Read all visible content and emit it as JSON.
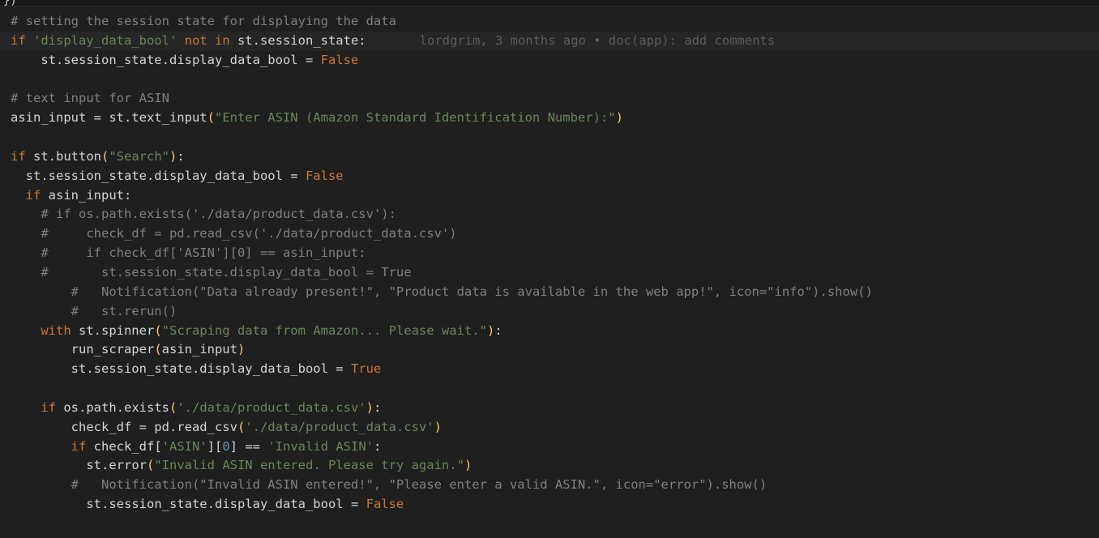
{
  "editor": {
    "top_fragment": "})",
    "blame": "lordgrim, 3 months ago • doc(app): add comments",
    "lines": [
      {
        "indent": 0,
        "tokens": [
          [
            "cmt",
            "# setting the session state for displaying the data"
          ]
        ]
      },
      {
        "indent": 0,
        "current": true,
        "tokens": [
          [
            "kw",
            "if "
          ],
          [
            "str",
            "'display_data_bool'"
          ],
          [
            "kw",
            " not in"
          ],
          [
            "txt",
            " st.session_state:"
          ]
        ]
      },
      {
        "indent": 2,
        "tokens": [
          [
            "txt",
            "st.session_state.display_data_bool = "
          ],
          [
            "bool",
            "False"
          ]
        ]
      },
      {
        "indent": 0,
        "tokens": []
      },
      {
        "indent": 0,
        "tokens": [
          [
            "cmt",
            "# text input for ASIN"
          ]
        ]
      },
      {
        "indent": 0,
        "tokens": [
          [
            "txt",
            "asin_input = st.text_input"
          ],
          [
            "par",
            "("
          ],
          [
            "str",
            "\"Enter ASIN (Amazon Standard Identification Number):\""
          ],
          [
            "par",
            ")"
          ]
        ]
      },
      {
        "indent": 0,
        "tokens": []
      },
      {
        "indent": 0,
        "tokens": [
          [
            "kw",
            "if"
          ],
          [
            "txt",
            " st.button"
          ],
          [
            "par",
            "("
          ],
          [
            "str",
            "\"Search\""
          ],
          [
            "par",
            ")"
          ],
          [
            "txt",
            ":"
          ]
        ]
      },
      {
        "indent": 1,
        "tokens": [
          [
            "txt",
            "st.session_state.display_data_bool = "
          ],
          [
            "bool",
            "False"
          ]
        ]
      },
      {
        "indent": 1,
        "tokens": [
          [
            "kw",
            "if"
          ],
          [
            "txt",
            " asin_input:"
          ]
        ]
      },
      {
        "indent": 2,
        "tokens": [
          [
            "cmt",
            "# if os.path.exists('./data/product_data.csv'):"
          ]
        ]
      },
      {
        "indent": 2,
        "tokens": [
          [
            "cmt",
            "#     check_df = pd.read_csv('./data/product_data.csv')"
          ]
        ]
      },
      {
        "indent": 2,
        "tokens": [
          [
            "cmt",
            "#     if check_df['ASIN'][0] == asin_input:"
          ]
        ]
      },
      {
        "indent": 2,
        "tokens": [
          [
            "cmt",
            "#       st.session_state.display_data_bool = True"
          ]
        ]
      },
      {
        "indent": 4,
        "tokens": [
          [
            "cmt",
            "#   Notification(\"Data already present!\", \"Product data is available in the web app!\", icon=\"info\").show()"
          ]
        ]
      },
      {
        "indent": 4,
        "tokens": [
          [
            "cmt",
            "#   st.rerun()"
          ]
        ]
      },
      {
        "indent": 2,
        "tokens": [
          [
            "kw",
            "with"
          ],
          [
            "txt",
            " st.spinner"
          ],
          [
            "par",
            "("
          ],
          [
            "str",
            "\"Scraping data from Amazon... Please wait.\""
          ],
          [
            "par",
            ")"
          ],
          [
            "txt",
            ":"
          ]
        ]
      },
      {
        "indent": 4,
        "tokens": [
          [
            "txt",
            "run_scraper"
          ],
          [
            "par",
            "("
          ],
          [
            "txt",
            "asin_input"
          ],
          [
            "par",
            ")"
          ]
        ]
      },
      {
        "indent": 4,
        "tokens": [
          [
            "txt",
            "st.session_state.display_data_bool = "
          ],
          [
            "bool",
            "True"
          ]
        ]
      },
      {
        "indent": 0,
        "tokens": []
      },
      {
        "indent": 2,
        "tokens": [
          [
            "kw",
            "if"
          ],
          [
            "txt",
            " os.path.exists"
          ],
          [
            "par",
            "("
          ],
          [
            "str",
            "'./data/product_data.csv'"
          ],
          [
            "par",
            ")"
          ],
          [
            "txt",
            ":"
          ]
        ]
      },
      {
        "indent": 4,
        "tokens": [
          [
            "txt",
            "check_df = pd.read_csv"
          ],
          [
            "par",
            "("
          ],
          [
            "str",
            "'./data/product_data.csv'"
          ],
          [
            "par",
            ")"
          ]
        ]
      },
      {
        "indent": 4,
        "tokens": [
          [
            "kw",
            "if"
          ],
          [
            "txt",
            " check_df["
          ],
          [
            "str",
            "'ASIN'"
          ],
          [
            "txt",
            "]["
          ],
          [
            "num",
            "0"
          ],
          [
            "txt",
            "] == "
          ],
          [
            "str",
            "'Invalid ASIN'"
          ],
          [
            "txt",
            ":"
          ]
        ]
      },
      {
        "indent": 5,
        "tokens": [
          [
            "txt",
            "st.error"
          ],
          [
            "par",
            "("
          ],
          [
            "str",
            "\"Invalid ASIN entered. Please try again.\""
          ],
          [
            "par",
            ")"
          ]
        ]
      },
      {
        "indent": 4,
        "tokens": [
          [
            "cmt",
            "#   Notification(\"Invalid ASIN entered!\", \"Please enter a valid ASIN.\", icon=\"error\").show()"
          ]
        ]
      },
      {
        "indent": 5,
        "tokens": [
          [
            "txt",
            "st.session_state.display_data_bool = "
          ],
          [
            "bool",
            "False"
          ]
        ]
      }
    ]
  }
}
